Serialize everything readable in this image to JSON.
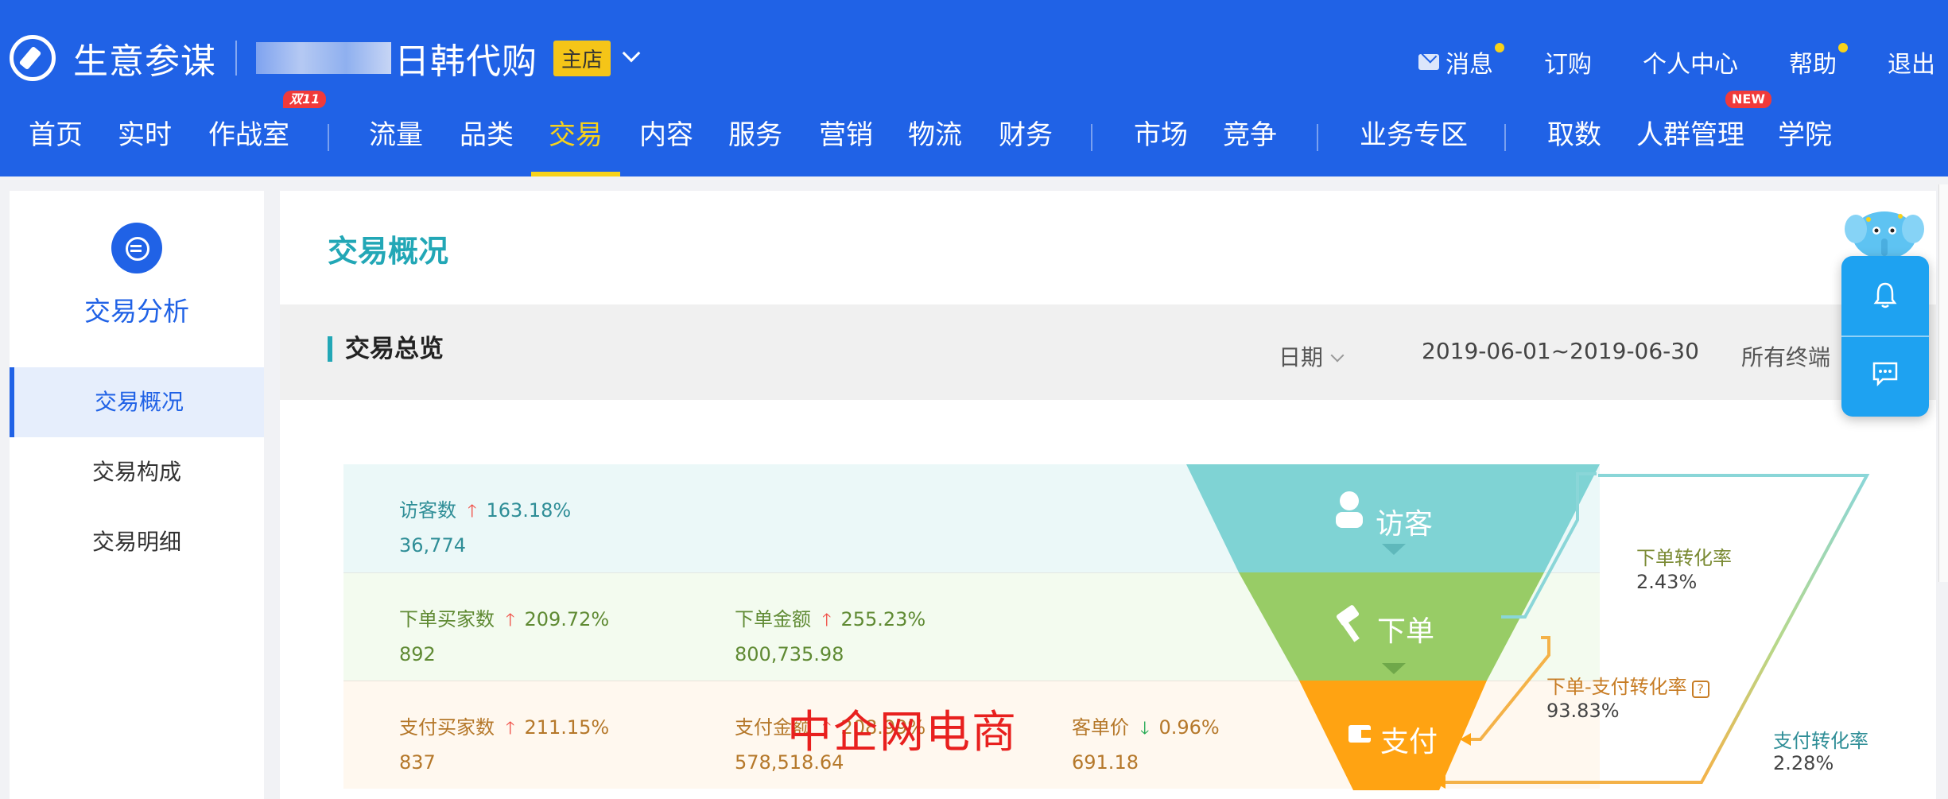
{
  "header": {
    "app_name": "生意参谋",
    "shop_name": "日韩代购",
    "shop_tag": "主店",
    "links": [
      {
        "label": "消息",
        "dot": true
      },
      {
        "label": "订购",
        "dot": false
      },
      {
        "label": "个人中心",
        "dot": false
      },
      {
        "label": "帮助",
        "dot": true
      },
      {
        "label": "退出",
        "dot": false
      }
    ]
  },
  "nav": {
    "items": [
      "首页",
      "实时",
      "作战室",
      "流量",
      "品类",
      "交易",
      "内容",
      "服务",
      "营销",
      "物流",
      "财务",
      "市场",
      "竞争",
      "业务专区",
      "取数",
      "人群管理",
      "学院"
    ],
    "active": "交易",
    "badges": {
      "warroom": "双11",
      "crowd": "NEW"
    }
  },
  "sidebar": {
    "title": "交易分析",
    "items": [
      {
        "label": "交易概况",
        "active": true
      },
      {
        "label": "交易构成",
        "active": false
      },
      {
        "label": "交易明细",
        "active": false
      }
    ]
  },
  "main": {
    "page_title": "交易概况",
    "section_title": "交易总览",
    "date_label": "日期",
    "date_range": "2019-06-01~2019-06-30",
    "terminal_label": "所有终端"
  },
  "funnel": {
    "visitors": {
      "label": "访客数",
      "change": "163.18%",
      "value": "36,774"
    },
    "order_buyers": {
      "label": "下单买家数",
      "change": "209.72%",
      "value": "892"
    },
    "order_amount": {
      "label": "下单金额",
      "change": "255.23%",
      "value": "800,735.98"
    },
    "pay_buyers": {
      "label": "支付买家数",
      "change": "211.15%",
      "value": "837"
    },
    "pay_amount": {
      "label": "支付金额",
      "change": "208.99%",
      "value": "578,518.64"
    },
    "unit_price": {
      "label": "客单价",
      "change": "0.96%",
      "value": "691.18"
    },
    "stages": {
      "visit": "访客",
      "order": "下单",
      "pay": "支付"
    },
    "rates": {
      "order_rate_label": "下单转化率",
      "order_rate": "2.43%",
      "order_pay_label": "下单-支付转化率",
      "order_pay": "93.83%",
      "pay_rate_label": "支付转化率",
      "pay_rate": "2.28%"
    }
  },
  "watermark": "中企网电商",
  "colors": {
    "brand_blue": "#2062e6",
    "accent_yellow": "#f7d21a",
    "teal": "#7fd3d4",
    "green": "#98cc66",
    "orange": "#ffa312"
  }
}
